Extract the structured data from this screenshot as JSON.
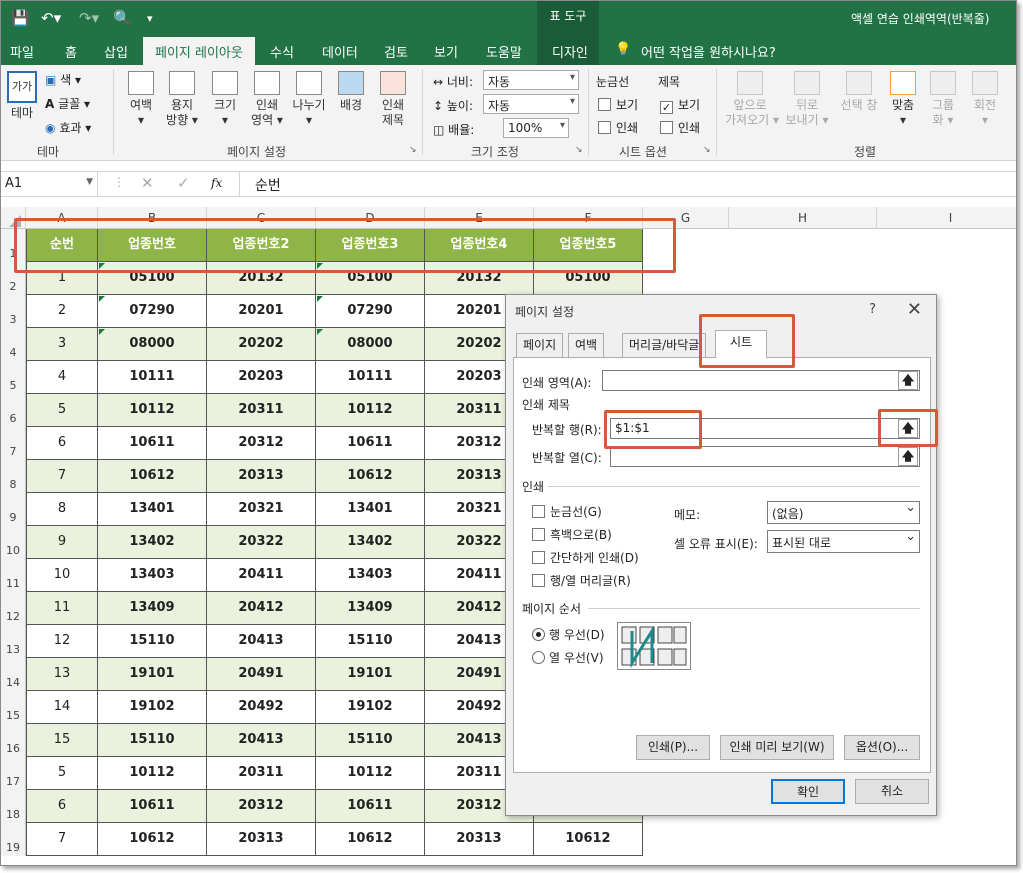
{
  "title": {
    "ctx_tab": "표 도구",
    "window_title": "액셀 연습 인쇄역역(반복줄)"
  },
  "menu": [
    "파일",
    "홈",
    "삽입",
    "페이지 레이아웃",
    "수식",
    "데이터",
    "검토",
    "보기",
    "도움말",
    "디자인"
  ],
  "tell_me": "어떤 작업을 원하시나요?",
  "ribbon": {
    "themes": {
      "theme": "테마",
      "colors": "색",
      "fonts": "글꼴",
      "effects": "효과",
      "group": "테마",
      "sample": "가가"
    },
    "page_setup": {
      "margins": [
        "여백",
        "▾"
      ],
      "orientation": [
        "용지",
        "방향 ▾"
      ],
      "size": [
        "크기",
        "▾"
      ],
      "print_area": [
        "인쇄",
        "영역 ▾"
      ],
      "breaks": [
        "나누기",
        "▾"
      ],
      "background": [
        "배경",
        ""
      ],
      "print_titles": [
        "인쇄",
        "제목"
      ],
      "group": "페이지 설정"
    },
    "scale": {
      "width_label": "너비:",
      "width_value": "자동",
      "height_label": "높이:",
      "height_value": "자동",
      "scale_label": "배율:",
      "scale_value": "100%",
      "group": "크기 조정"
    },
    "sheet_options": {
      "gridlines": "눈금선",
      "headings": "제목",
      "view": "보기",
      "print": "인쇄",
      "group": "시트 옵션"
    },
    "arrange": {
      "forward": [
        "앞으로",
        "가져오기 ▾"
      ],
      "backward": [
        "뒤로",
        "보내기 ▾"
      ],
      "selection": [
        "선택 창",
        ""
      ],
      "align": [
        "맞춤",
        "▾"
      ],
      "group_btn": [
        "그룹",
        "화 ▾"
      ],
      "rotate": [
        "회전",
        "▾"
      ],
      "group": "정렬"
    }
  },
  "formula_bar": {
    "name_box": "A1",
    "fx": "fx",
    "content": "순번"
  },
  "columns": [
    "A",
    "B",
    "C",
    "D",
    "E",
    "F",
    "G",
    "H",
    "I"
  ],
  "table": {
    "header": [
      "순번",
      "업종번호",
      "업종번호2",
      "업종번호3",
      "업종번호4",
      "업종번호5"
    ],
    "rows": [
      [
        "1",
        "05100",
        "20132",
        "05100",
        "20132",
        "05100"
      ],
      [
        "2",
        "07290",
        "20201",
        "07290",
        "20201",
        ""
      ],
      [
        "3",
        "08000",
        "20202",
        "08000",
        "20202",
        ""
      ],
      [
        "4",
        "10111",
        "20203",
        "10111",
        "20203",
        ""
      ],
      [
        "5",
        "10112",
        "20311",
        "10112",
        "20311",
        ""
      ],
      [
        "6",
        "10611",
        "20312",
        "10611",
        "20312",
        ""
      ],
      [
        "7",
        "10612",
        "20313",
        "10612",
        "20313",
        ""
      ],
      [
        "8",
        "13401",
        "20321",
        "13401",
        "20321",
        ""
      ],
      [
        "9",
        "13402",
        "20322",
        "13402",
        "20322",
        ""
      ],
      [
        "10",
        "13403",
        "20411",
        "13403",
        "20411",
        ""
      ],
      [
        "11",
        "13409",
        "20412",
        "13409",
        "20412",
        ""
      ],
      [
        "12",
        "15110",
        "20413",
        "15110",
        "20413",
        ""
      ],
      [
        "13",
        "19101",
        "20491",
        "19101",
        "20491",
        ""
      ],
      [
        "14",
        "19102",
        "20492",
        "19102",
        "20492",
        ""
      ],
      [
        "15",
        "15110",
        "20413",
        "15110",
        "20413",
        ""
      ],
      [
        "5",
        "10112",
        "20311",
        "10112",
        "20311",
        ""
      ],
      [
        "6",
        "10611",
        "20312",
        "10611",
        "20312",
        ""
      ],
      [
        "7",
        "10612",
        "20313",
        "10612",
        "20313",
        "10612"
      ]
    ]
  },
  "dialog": {
    "title": "페이지 설정",
    "help": "?",
    "close": "✕",
    "tabs": [
      "페이지",
      "여백",
      "머리글/바닥글",
      "시트"
    ],
    "print_area_label": "인쇄 영역(A):",
    "print_area_value": "",
    "print_titles_section": "인쇄 제목",
    "rows_repeat_label": "반복할 행(R):",
    "rows_repeat_value": "$1:$1",
    "cols_repeat_label": "반복할 열(C):",
    "cols_repeat_value": "",
    "print_section": "인쇄",
    "checks": [
      "눈금선(G)",
      "흑백으로(B)",
      "간단하게 인쇄(D)",
      "행/열 머리글(R)"
    ],
    "comments_label": "메모:",
    "comments_value": "(없음)",
    "errors_label": "셀 오류 표시(E):",
    "errors_value": "표시된 대로",
    "order_section": "페이지 순서",
    "order_options": [
      "행 우선(D)",
      "열 우선(V)"
    ],
    "buttons": {
      "print": "인쇄(P)...",
      "preview": "인쇄 미리 보기(W)",
      "options": "옵션(O)...",
      "ok": "확인",
      "cancel": "취소"
    }
  },
  "accent": "#217346",
  "header_green": "#8fb448",
  "highlight": "#d45a3a"
}
